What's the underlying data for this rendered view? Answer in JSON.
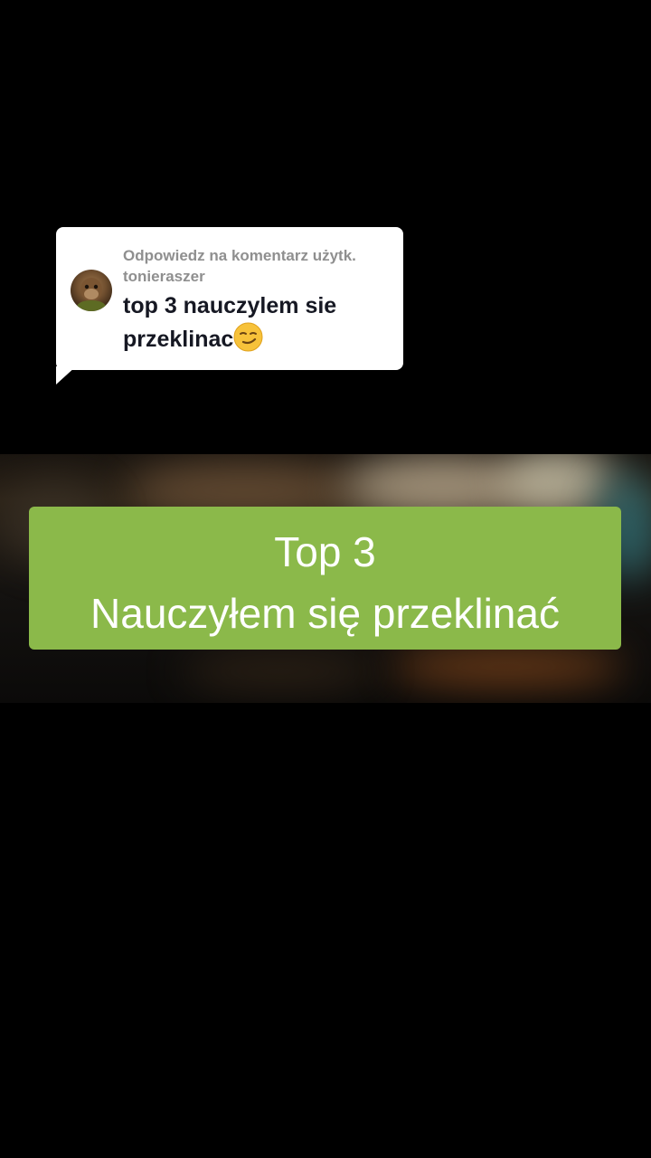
{
  "reply": {
    "header_line1": "Odpowiedz na komentarz użytk.",
    "header_line2": "tonieraszer",
    "comment_text": "top 3 nauczylem sie przeklinac",
    "emoji_icon": "smirking-face-emoji"
  },
  "caption": {
    "line1": "Top 3",
    "line2": "Nauczyłem się przeklinać",
    "background_color": "#8bb94a"
  }
}
